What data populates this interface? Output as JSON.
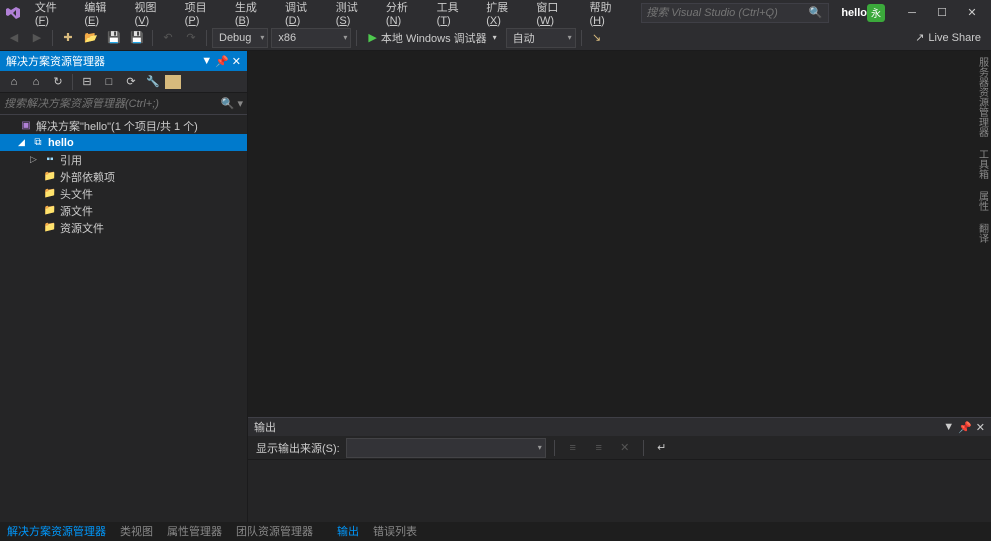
{
  "title": {
    "menus": [
      {
        "label": "文件",
        "key": "F"
      },
      {
        "label": "编辑",
        "key": "E"
      },
      {
        "label": "视图",
        "key": "V"
      },
      {
        "label": "项目",
        "key": "P"
      },
      {
        "label": "生成",
        "key": "B"
      },
      {
        "label": "调试",
        "key": "D"
      },
      {
        "label": "测试",
        "key": "S"
      },
      {
        "label": "分析",
        "key": "N"
      },
      {
        "label": "工具",
        "key": "T"
      },
      {
        "label": "扩展",
        "key": "X"
      },
      {
        "label": "窗口",
        "key": "W"
      },
      {
        "label": "帮助",
        "key": "H"
      }
    ],
    "search_placeholder": "搜索 Visual Studio (Ctrl+Q)",
    "project": "hello",
    "avatar": "永"
  },
  "toolbar": {
    "config": "Debug",
    "platform": "x86",
    "run_label": "本地 Windows 调试器",
    "auto_label": "自动",
    "live_share": "Live Share"
  },
  "solution_explorer": {
    "title": "解决方案资源管理器",
    "search_placeholder": "搜索解决方案资源管理器(Ctrl+;)",
    "solution_label": "解决方案\"hello\"(1 个项目/共 1 个)",
    "project_label": "hello",
    "nodes": {
      "references": "引用",
      "external": "外部依赖项",
      "headers": "头文件",
      "sources": "源文件",
      "resources": "资源文件"
    }
  },
  "output": {
    "title": "输出",
    "source_label": "显示输出来源(S):"
  },
  "right_rail": [
    "服务器资源管理器",
    "工具箱",
    "属性",
    "翻译"
  ],
  "status": {
    "tabs": [
      "解决方案资源管理器",
      "类视图",
      "属性管理器",
      "团队资源管理器"
    ],
    "right_tabs": [
      "输出",
      "错误列表"
    ]
  }
}
